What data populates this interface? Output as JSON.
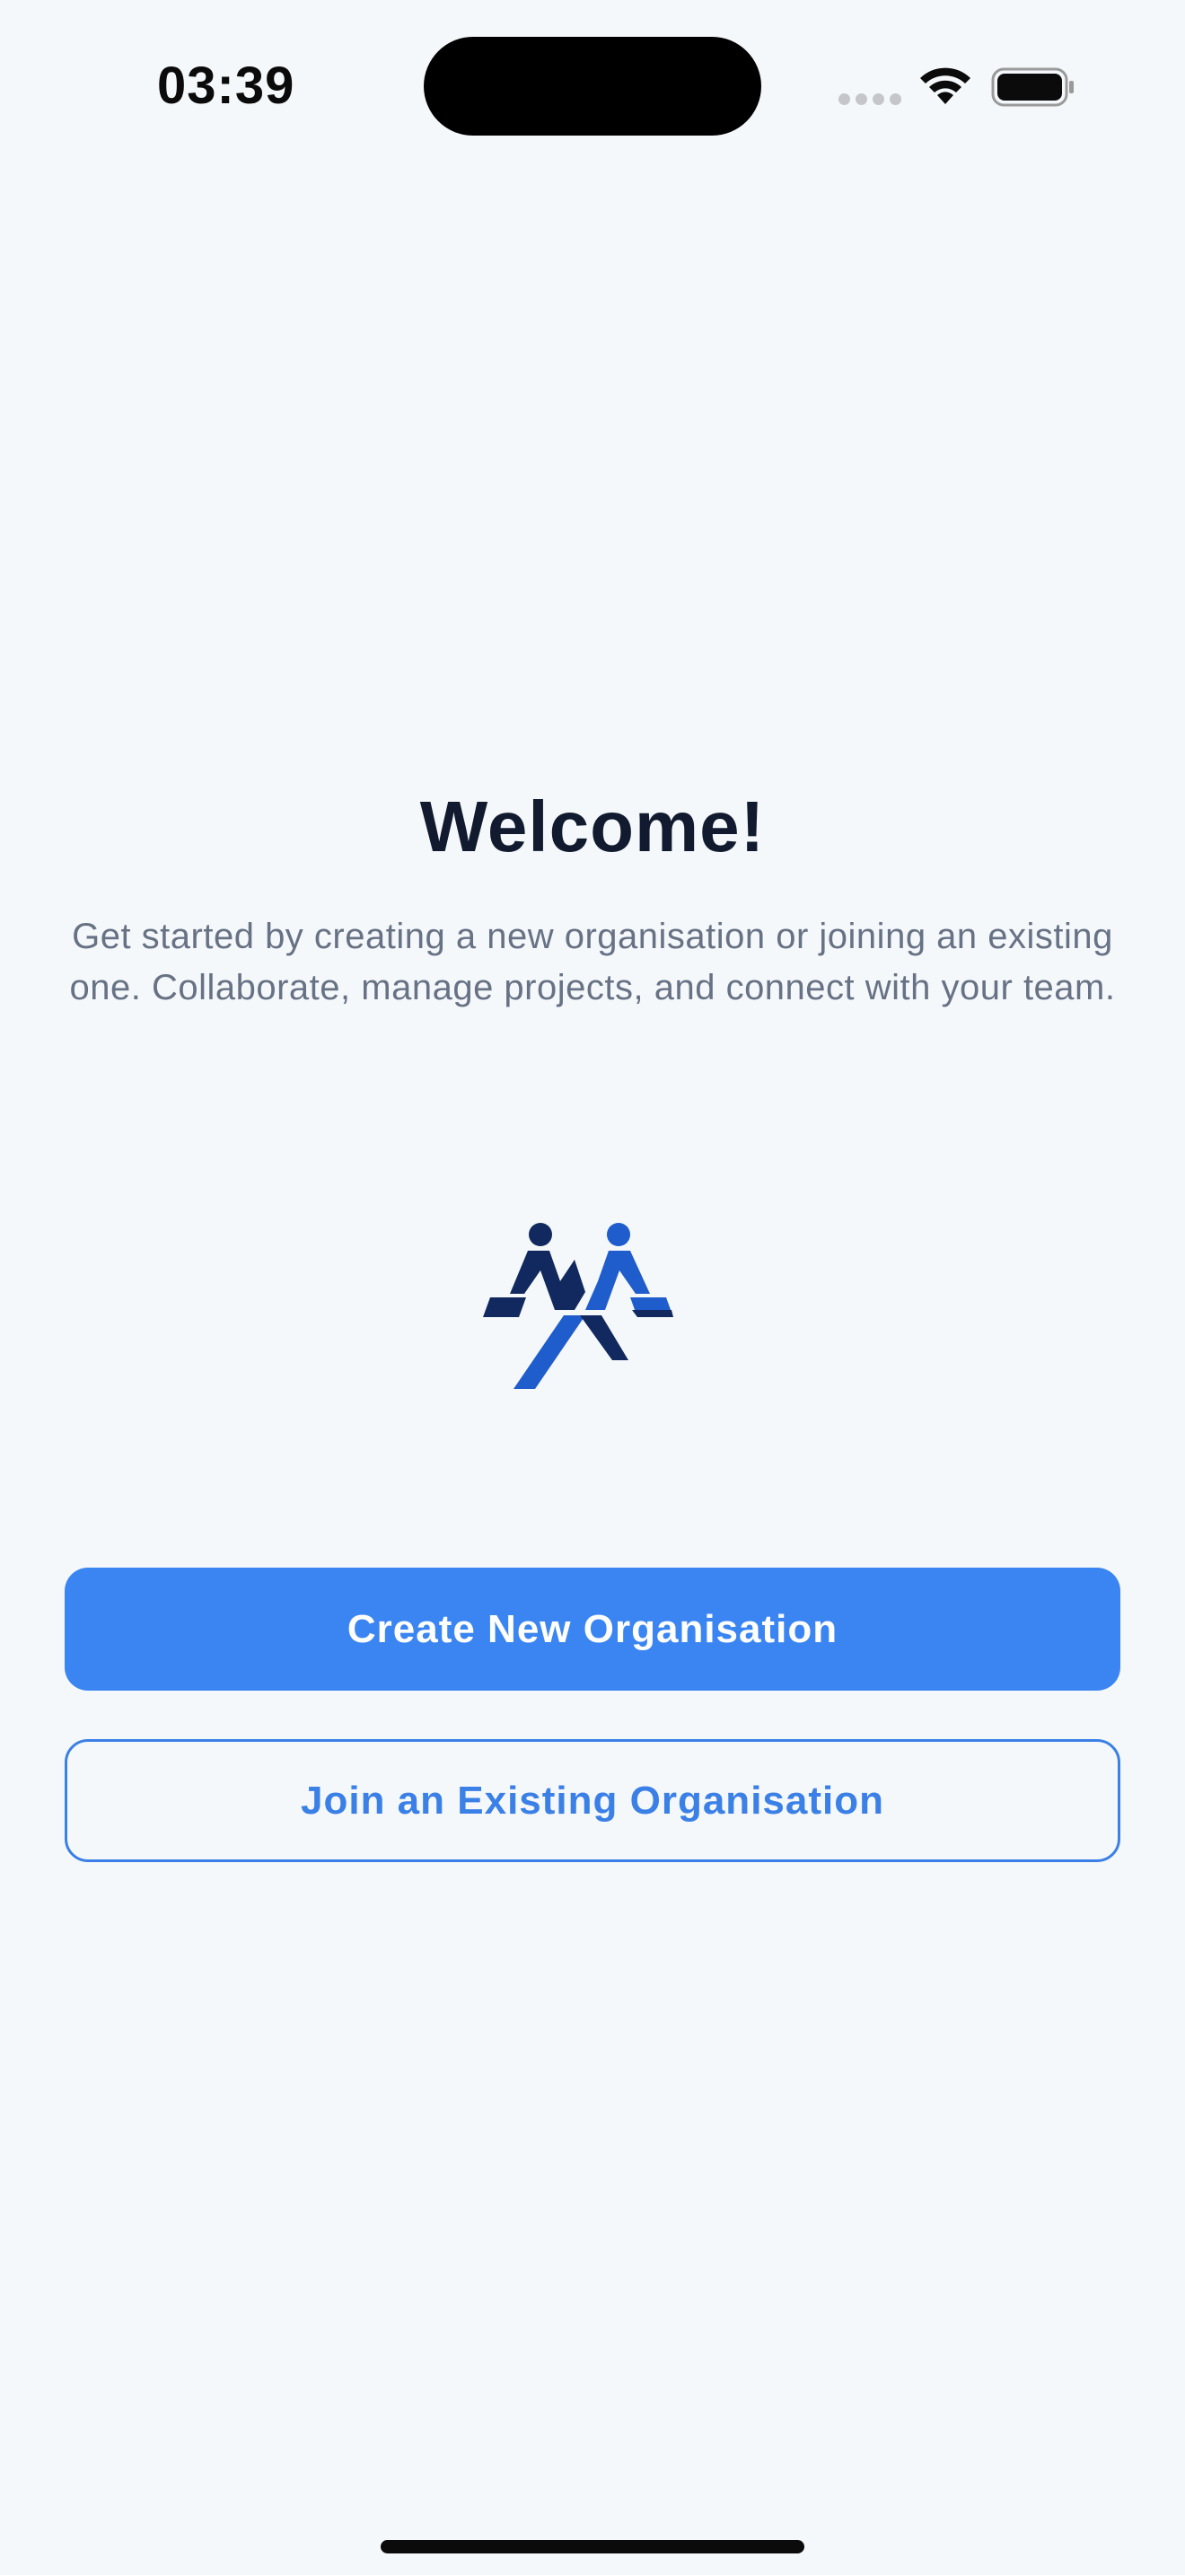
{
  "status_bar": {
    "time": "03:39"
  },
  "welcome": {
    "title": "Welcome!",
    "description": "Get started by creating a new organisation or joining an existing one. Collaborate, manage projects, and connect with your team."
  },
  "actions": {
    "create_label": "Create New Organisation",
    "join_label": "Join an Existing Organisation"
  },
  "colors": {
    "background": "#f5f8fb",
    "primary": "#3b85f2",
    "title": "#111a2e",
    "body_text": "#687285",
    "logo_dark": "#11295e",
    "logo_light": "#1f5ccc"
  },
  "icons": {
    "signal": "cellular-signal-icon",
    "wifi": "wifi-icon",
    "battery": "battery-icon",
    "logo": "team-logo-icon"
  }
}
